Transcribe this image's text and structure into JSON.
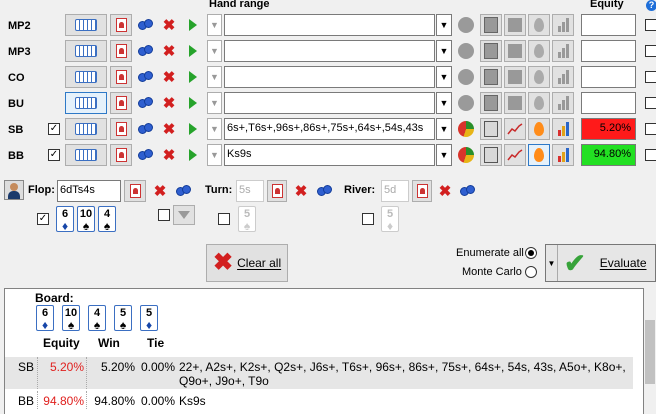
{
  "headers": {
    "hand_range": "Hand range",
    "equity": "Equity",
    "help": "?"
  },
  "rows": [
    {
      "label": "MP2",
      "checked": false,
      "has_checkbox": false,
      "range": "",
      "equity": "",
      "active": false,
      "selected": false
    },
    {
      "label": "MP3",
      "checked": false,
      "has_checkbox": false,
      "range": "",
      "equity": "",
      "active": false,
      "selected": false
    },
    {
      "label": "CO",
      "checked": false,
      "has_checkbox": false,
      "range": "",
      "equity": "",
      "active": false,
      "selected": false
    },
    {
      "label": "BU",
      "checked": false,
      "has_checkbox": false,
      "range": "",
      "equity": "",
      "active": false,
      "selected": true
    },
    {
      "label": "SB",
      "checked": true,
      "has_checkbox": true,
      "range": "6s+,T6s+,96s+,86s+,75s+,64s+,54s,43s",
      "equity": "5.20%",
      "equity_color": "#ff1a1a",
      "active": true,
      "selected": false
    },
    {
      "label": "BB",
      "checked": true,
      "has_checkbox": true,
      "range": "Ks9s",
      "equity": "94.80%",
      "equity_color": "#22e022",
      "active": true,
      "selected": false
    }
  ],
  "board_inputs": {
    "flop_label": "Flop:",
    "flop_value": "6dTs4s",
    "turn_label": "Turn:",
    "turn_value": "5s",
    "river_label": "River:",
    "river_value": "5d"
  },
  "flop_cards": [
    {
      "rank": "6",
      "suit": "♦",
      "cls": "d"
    },
    {
      "rank": "10",
      "suit": "♠",
      "cls": "s"
    },
    {
      "rank": "4",
      "suit": "♠",
      "cls": "s"
    }
  ],
  "turn_card": {
    "rank": "5",
    "suit": "♠"
  },
  "river_card": {
    "rank": "5",
    "suit": "♦"
  },
  "actions": {
    "clear_all": "Clear all",
    "enumerate_all": "Enumerate all",
    "monte_carlo": "Monte Carlo",
    "evaluate": "Evaluate",
    "mode": "enumerate"
  },
  "results": {
    "board_label": "Board:",
    "board_cards": [
      {
        "rank": "6",
        "suit": "♦",
        "cls": "d"
      },
      {
        "rank": "10",
        "suit": "♠",
        "cls": "s"
      },
      {
        "rank": "4",
        "suit": "♠",
        "cls": "s"
      },
      {
        "rank": "5",
        "suit": "♠",
        "cls": "s"
      },
      {
        "rank": "5",
        "suit": "♦",
        "cls": "d"
      }
    ],
    "columns": [
      "Equity",
      "Win",
      "Tie"
    ],
    "rows": [
      {
        "player": "SB",
        "equity": "5.20%",
        "win": "5.20%",
        "tie": "0.00%",
        "hand_line1": "22+, A2s+, K2s+, Q2s+, J6s+, T6s+, 96s+, 86s+, 75s+, 64s+, 54s, 43s, A5o+, K8o+,",
        "hand_line2": "Q9o+, J9o+, T9o"
      },
      {
        "player": "BB",
        "equity": "94.80%",
        "win": "94.80%",
        "tie": "0.00%",
        "hand_line1": "Ks9s",
        "hand_line2": ""
      }
    ],
    "equity_text_color": "#e0201e"
  }
}
